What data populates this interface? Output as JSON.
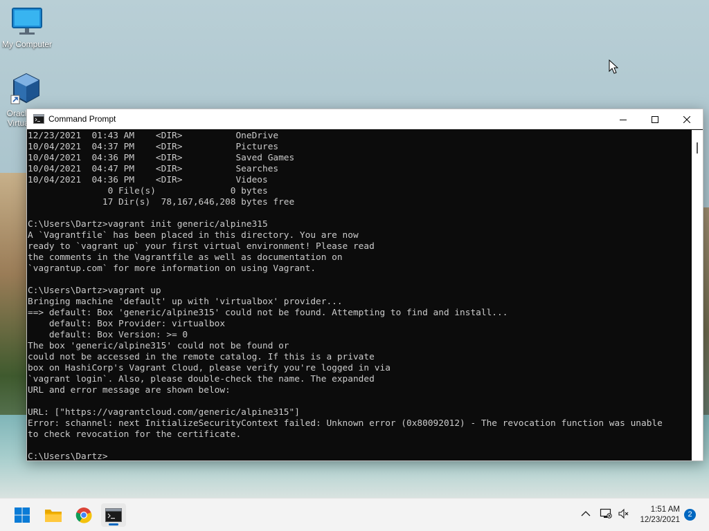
{
  "desktop": {
    "icons": [
      {
        "label": "My Computer",
        "icon": "monitor-icon"
      },
      {
        "label": "Oracle VM VirtualBox",
        "icon": "virtualbox-icon"
      }
    ]
  },
  "window": {
    "title": "Command Prompt",
    "controls": [
      "minimize-icon",
      "maximize-icon",
      "close-icon"
    ]
  },
  "console": {
    "lines": [
      "12/23/2021  01:43 AM    <DIR>          OneDrive",
      "10/04/2021  04:37 PM    <DIR>          Pictures",
      "10/04/2021  04:36 PM    <DIR>          Saved Games",
      "10/04/2021  04:47 PM    <DIR>          Searches",
      "10/04/2021  04:36 PM    <DIR>          Videos",
      "               0 File(s)              0 bytes",
      "              17 Dir(s)  78,167,646,208 bytes free",
      "",
      "C:\\Users\\Dartz>vagrant init generic/alpine315",
      "A `Vagrantfile` has been placed in this directory. You are now",
      "ready to `vagrant up` your first virtual environment! Please read",
      "the comments in the Vagrantfile as well as documentation on",
      "`vagrantup.com` for more information on using Vagrant.",
      "",
      "C:\\Users\\Dartz>vagrant up",
      "Bringing machine 'default' up with 'virtualbox' provider...",
      "==> default: Box 'generic/alpine315' could not be found. Attempting to find and install...",
      "    default: Box Provider: virtualbox",
      "    default: Box Version: >= 0",
      "The box 'generic/alpine315' could not be found or",
      "could not be accessed in the remote catalog. If this is a private",
      "box on HashiCorp's Vagrant Cloud, please verify you're logged in via",
      "`vagrant login`. Also, please double-check the name. The expanded",
      "URL and error message are shown below:",
      "",
      "URL: [\"https://vagrantcloud.com/generic/alpine315\"]",
      "Error: schannel: next InitializeSecurityContext failed: Unknown error (0x80092012) - The revocation function was unable",
      "to check revocation for the certificate.",
      "",
      "C:\\Users\\Dartz>"
    ]
  },
  "taskbar": {
    "apps": [
      "start-icon",
      "file-explorer-icon",
      "chrome-icon",
      "command-prompt-icon"
    ],
    "active_app": "command-prompt-icon",
    "tray": [
      "chevron-up-icon",
      "network-icon",
      "volume-muted-icon"
    ],
    "time": "1:51 AM",
    "date": "12/23/2021",
    "notifications": "2"
  },
  "colors": {
    "console_bg": "#0c0c0c",
    "console_fg": "#cccccc",
    "accent": "#0067c0"
  }
}
